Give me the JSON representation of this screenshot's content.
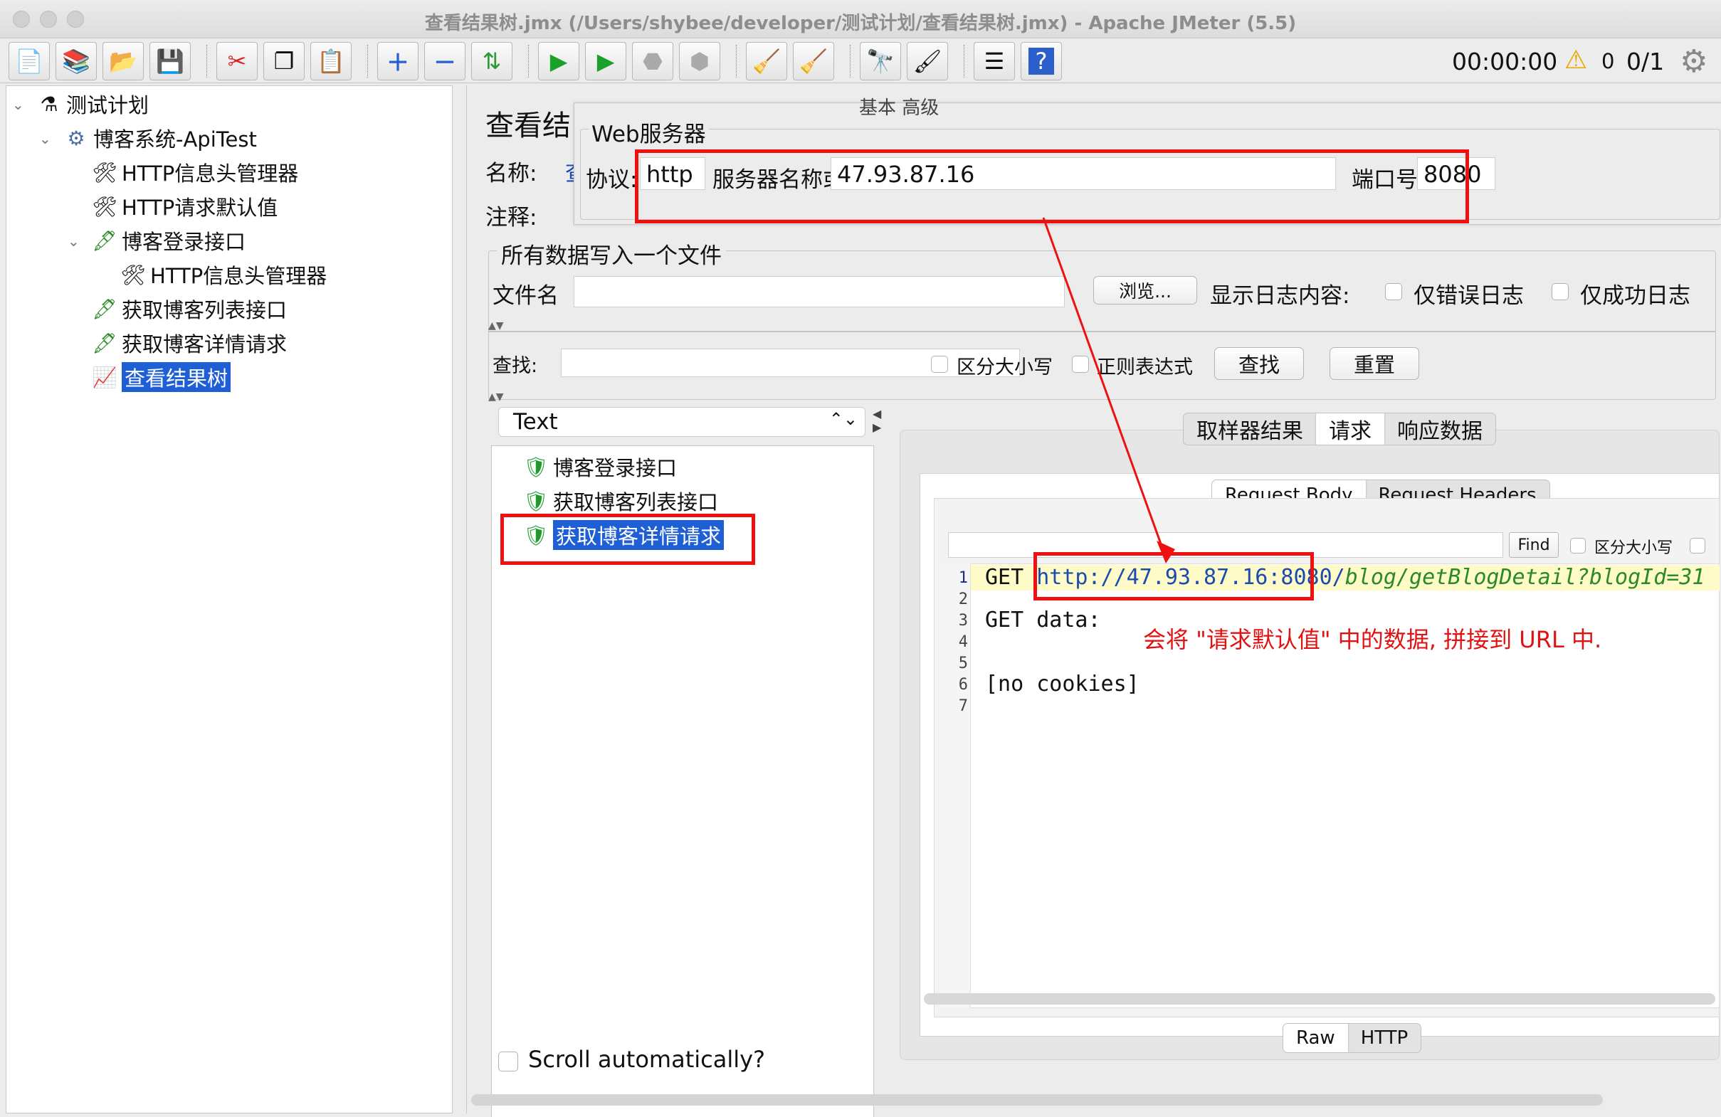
{
  "window": {
    "title": "查看结果树.jmx (/Users/shybee/developer/测试计划/查看结果树.jmx) - Apache JMeter (5.5)"
  },
  "toolbar": {
    "timer": "00:00:00",
    "warnings": "0",
    "threads": "0/1"
  },
  "tree": {
    "items": [
      {
        "label": "测试计划",
        "icon": "flask-icon"
      },
      {
        "label": "博客系统-ApiTest",
        "icon": "gear-icon"
      },
      {
        "label": "HTTP信息头管理器",
        "icon": "wrench-icon"
      },
      {
        "label": "HTTP请求默认值",
        "icon": "wrench-icon"
      },
      {
        "label": "博客登录接口",
        "icon": "pipette-icon"
      },
      {
        "label": "HTTP信息头管理器",
        "icon": "wrench-icon"
      },
      {
        "label": "获取博客列表接口",
        "icon": "pipette-icon"
      },
      {
        "label": "获取博客详情请求",
        "icon": "pipette-icon"
      },
      {
        "label": "查看结果树",
        "icon": "chart-icon"
      }
    ]
  },
  "panel": {
    "title": "查看结",
    "name_label": "名称:",
    "comment_label": "注释:",
    "name_value": "查",
    "overlay": {
      "tabs_hint": "基本  高级",
      "group_title": "Web服务器",
      "protocol_label": "协议:",
      "protocol_value": "http",
      "server_label": "服务器名称或IP:",
      "server_value": "47.93.87.16",
      "port_label": "端口号:",
      "port_value": "8080"
    },
    "file_group_title": "所有数据写入一个文件",
    "filename_label": "文件名",
    "browse_button": "浏览...",
    "log_label": "显示日志内容:",
    "errors_only": "仅错误日志",
    "success_only": "仅成功日志",
    "search_label": "查找:",
    "case_sensitive": "区分大小写",
    "regex": "正则表达式",
    "find_button": "查找",
    "reset_button": "重置",
    "renderer": "Text",
    "results": [
      "博客登录接口",
      "获取博客列表接口",
      "获取博客详情请求"
    ],
    "scroll_auto": "Scroll automatically?",
    "tabs": [
      "取样器结果",
      "请求",
      "响应数据"
    ],
    "subtabs": [
      "Request Body",
      "Request Headers"
    ],
    "find_small": "Find",
    "case_small": "区分大小写",
    "code": {
      "method": "GET",
      "url_host": "http://47.93.87.16:8080/",
      "url_path": "blog/getBlogDetail?blogId=31",
      "line3": "GET data:",
      "line6": "[no cookies]",
      "line_numbers": [
        "1",
        "2",
        "3",
        "4",
        "5",
        "6",
        "7"
      ]
    },
    "annotation": "会将 \"请求默认值\" 中的数据, 拼接到 URL 中.",
    "bottom_tabs": [
      "Raw",
      "HTTP"
    ]
  }
}
